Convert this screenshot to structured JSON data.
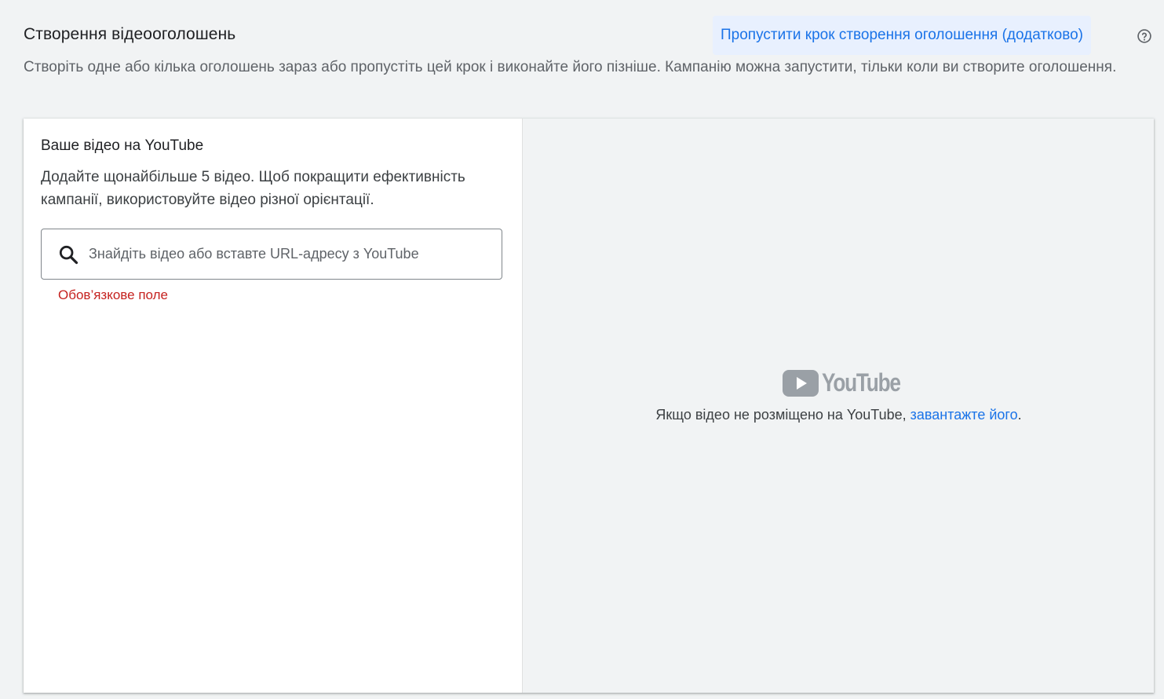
{
  "header": {
    "title": "Створення відеооголошень",
    "skip_label": "Пропустити крок створення оголошення (додатково)",
    "help_icon": "help-circle-icon",
    "description": "Створіть одне або кілька оголошень зараз або пропустіть цей крок і виконайте його пізніше. Кампанію можна запустити, тільки коли ви створите оголошення."
  },
  "video_panel": {
    "title": "Ваше відео на YouTube",
    "description": "Додайте щонайбільше 5 відео. Щоб покращити ефективність кампанії, використовуйте відео різної орієнтації.",
    "search": {
      "icon": "search-icon",
      "placeholder": "Знайдіть відео або вставте URL-адресу з YouTube",
      "value": ""
    },
    "error": "Обов’язкове поле"
  },
  "preview_panel": {
    "logo_text": "YouTube",
    "hint_text": "Якщо відео не розміщено на YouTube, ",
    "upload_link": "завантажте його",
    "hint_end": "."
  },
  "colors": {
    "accent": "#1a73e8",
    "error": "#c5221f",
    "background": "#f1f3f4"
  }
}
